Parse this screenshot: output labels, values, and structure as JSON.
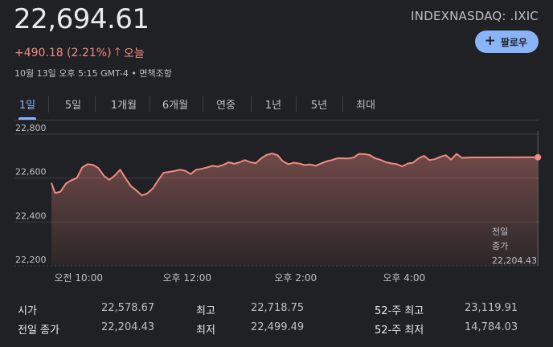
{
  "quote": {
    "price": "22,694.61",
    "change": "+490.18 (2.21%)",
    "change_icon": "arrow-up-icon",
    "period": "오늘",
    "timestamp": "10월 13일 오후 5:15 GMT-4 • 면책조항",
    "ticker": "INDEXNASDAQ: .IXIC",
    "follow_label": "팔로우",
    "accent_color": "#8ab4f8",
    "change_color": "#f28b82"
  },
  "tabs": [
    {
      "label": "1일",
      "active": true
    },
    {
      "label": "5일"
    },
    {
      "label": "1개월"
    },
    {
      "label": "6개월"
    },
    {
      "label": "연중"
    },
    {
      "label": "1년"
    },
    {
      "label": "5년"
    },
    {
      "label": "최대"
    }
  ],
  "chart_data": {
    "type": "area",
    "x_unit": "minutes after 9:30 AM",
    "ylim": [
      22200,
      22800
    ],
    "y_ticks": [
      "22,800",
      "22,600",
      "22,400",
      "22,200"
    ],
    "x_ticks": [
      "오전 10:00",
      "오후 12:00",
      "오후 2:00",
      "오후 4:00"
    ],
    "grid": true,
    "previous_close_label": [
      "전일",
      "종가",
      "22,204.43"
    ],
    "last_value": 22694.61,
    "values": [
      [
        0,
        22578
      ],
      [
        4,
        22532
      ],
      [
        10,
        22538
      ],
      [
        16,
        22575
      ],
      [
        22,
        22590
      ],
      [
        28,
        22600
      ],
      [
        34,
        22648
      ],
      [
        40,
        22663
      ],
      [
        46,
        22660
      ],
      [
        52,
        22645
      ],
      [
        58,
        22610
      ],
      [
        64,
        22592
      ],
      [
        70,
        22612
      ],
      [
        76,
        22638
      ],
      [
        82,
        22598
      ],
      [
        88,
        22563
      ],
      [
        94,
        22543
      ],
      [
        100,
        22521
      ],
      [
        106,
        22530
      ],
      [
        112,
        22552
      ],
      [
        118,
        22590
      ],
      [
        124,
        22624
      ],
      [
        130,
        22628
      ],
      [
        136,
        22632
      ],
      [
        142,
        22638
      ],
      [
        148,
        22633
      ],
      [
        154,
        22618
      ],
      [
        160,
        22638
      ],
      [
        166,
        22642
      ],
      [
        172,
        22648
      ],
      [
        178,
        22656
      ],
      [
        184,
        22652
      ],
      [
        190,
        22660
      ],
      [
        196,
        22672
      ],
      [
        202,
        22665
      ],
      [
        208,
        22672
      ],
      [
        214,
        22682
      ],
      [
        220,
        22672
      ],
      [
        226,
        22668
      ],
      [
        232,
        22690
      ],
      [
        238,
        22706
      ],
      [
        244,
        22712
      ],
      [
        250,
        22704
      ],
      [
        256,
        22676
      ],
      [
        262,
        22663
      ],
      [
        268,
        22670
      ],
      [
        274,
        22666
      ],
      [
        280,
        22659
      ],
      [
        286,
        22662
      ],
      [
        292,
        22656
      ],
      [
        298,
        22666
      ],
      [
        304,
        22676
      ],
      [
        310,
        22682
      ],
      [
        316,
        22690
      ],
      [
        322,
        22690
      ],
      [
        328,
        22689
      ],
      [
        334,
        22693
      ],
      [
        340,
        22710
      ],
      [
        346,
        22709
      ],
      [
        352,
        22705
      ],
      [
        358,
        22690
      ],
      [
        364,
        22683
      ],
      [
        370,
        22672
      ],
      [
        376,
        22667
      ],
      [
        382,
        22663
      ],
      [
        388,
        22653
      ],
      [
        394,
        22666
      ],
      [
        400,
        22670
      ],
      [
        406,
        22690
      ],
      [
        412,
        22701
      ],
      [
        418,
        22682
      ],
      [
        424,
        22686
      ],
      [
        430,
        22697
      ],
      [
        436,
        22704
      ],
      [
        442,
        22684
      ],
      [
        448,
        22710
      ],
      [
        454,
        22692
      ],
      [
        460,
        22693
      ],
      [
        465,
        22694
      ],
      [
        538,
        22694.61
      ]
    ]
  },
  "stats": {
    "open_label": "시가",
    "open_value": "22,578.67",
    "prev_close_label": "전일 종가",
    "prev_close_value": "22,204.43",
    "high_label": "최고",
    "high_value": "22,718.75",
    "low_label": "최저",
    "low_value": "22,499.49",
    "high52_label": "52-주 최고",
    "high52_value": "23,119.91",
    "low52_label": "52-주 최저",
    "low52_value": "14,784.03"
  }
}
